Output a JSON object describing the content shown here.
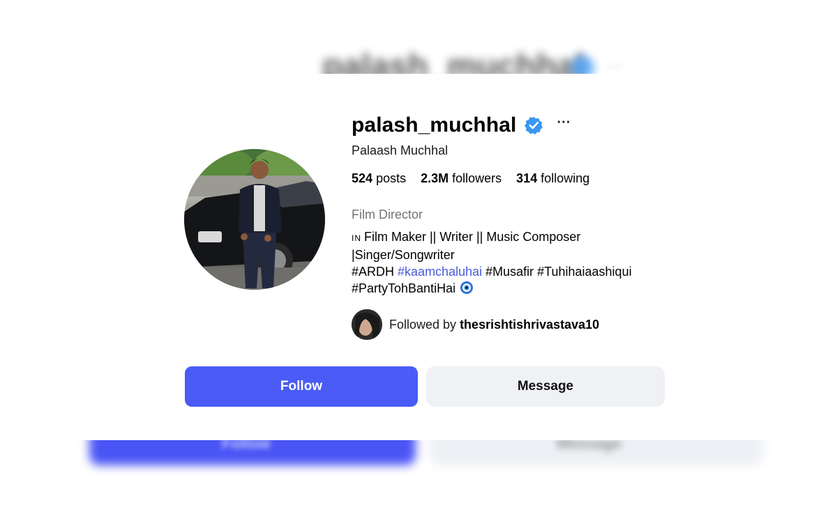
{
  "profile": {
    "username": "palash_muchhal",
    "full_name": "Palaash Muchhal",
    "more_label": "···",
    "stats": {
      "posts_count": "524",
      "posts_label": "posts",
      "followers_count": "2.3M",
      "followers_label": "followers",
      "following_count": "314",
      "following_label": "following"
    },
    "category": "Film Director",
    "bio": {
      "line1_prefix": "IN",
      "line1": "Film Maker || Writer || Music Composer",
      "line2": "|Singer/Songwriter",
      "line3_tag1": "#ARDH",
      "line3_tag2": "#kaamchaluhai",
      "line3_tag3": "#Musafir #Tuhihaiaashiqui",
      "line4": "#PartyTohBantiHai"
    },
    "followed_by_prefix": "Followed by",
    "followed_by_user": "thesrishtishrivastava10"
  },
  "actions": {
    "follow_label": "Follow",
    "message_label": "Message"
  },
  "background": {
    "title": "palash_muchhal",
    "follow_label": "Follow",
    "message_label": "Message"
  },
  "colors": {
    "follow_button": "#4a5bf6",
    "message_button": "#eff1f5",
    "verified_badge": "#3897f0",
    "link": "#4a5ad8",
    "category_text": "#737373"
  },
  "icons": {
    "verified": "verified-badge-icon",
    "more": "more-options-icon",
    "evil_eye": "nazar-amulet-icon"
  }
}
